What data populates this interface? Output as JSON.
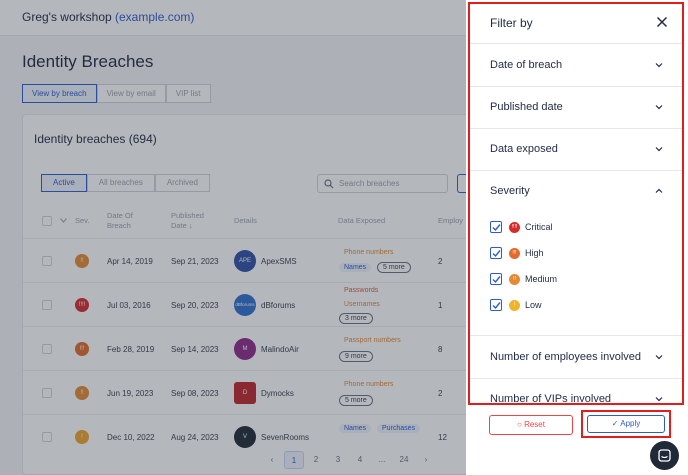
{
  "header": {
    "workspace_name": "Greg's workshop",
    "workspace_domain": "(example.com)"
  },
  "page": {
    "title": "Identity Breaches"
  },
  "view_tabs": [
    {
      "label": "View by breach",
      "active": true
    },
    {
      "label": "View by email",
      "active": false
    },
    {
      "label": "VIP list",
      "active": false
    }
  ],
  "card": {
    "title": "Identity breaches (694)",
    "sub_tabs": [
      {
        "label": "Active",
        "active": true
      },
      {
        "label": "All breaches",
        "active": false
      },
      {
        "label": "Archived",
        "active": false
      }
    ],
    "search_placeholder": "Search breaches"
  },
  "table": {
    "headers": {
      "sev": "Sev.",
      "date_of_breach": "Date Of Breach",
      "published_date": "Published Date ↓",
      "details": "Details",
      "data_exposed": "Data Exposed",
      "employees": "Employ"
    },
    "rows": [
      {
        "sev": "!!",
        "sev_color": "#e58a34",
        "date": "Apr 14, 2019",
        "published": "Sep 21, 2023",
        "logo": "APE",
        "logo_color": "#2f4fa8",
        "name": "ApexSMS",
        "chips": [
          "Phone numbers",
          "Names"
        ],
        "more": "5 more",
        "count": "2"
      },
      {
        "sev": "!!!!",
        "sev_color": "#d62b2b",
        "date": "Jul 03, 2016",
        "published": "Sep 20, 2023",
        "logo": "dBforums",
        "logo_color": "#2e6fcf",
        "name": "dBforums",
        "chips": [
          "Passwords",
          "Usernames"
        ],
        "more": "3 more",
        "count": "1"
      },
      {
        "sev": "!!!",
        "sev_color": "#e36a2a",
        "date": "Feb 28, 2019",
        "published": "Sep 14, 2023",
        "logo": "M",
        "logo_color": "#8e2a8a",
        "name": "MalindoAir",
        "chips": [
          "Passport numbers"
        ],
        "more": "9 more",
        "count": "8"
      },
      {
        "sev": "!!",
        "sev_color": "#e58a34",
        "date": "Jun 19, 2023",
        "published": "Sep 08, 2023",
        "logo": "D",
        "logo_color": "#c0262d",
        "name": "Dymocks",
        "chips": [
          "Phone numbers"
        ],
        "more": "5 more",
        "count": "2"
      },
      {
        "sev": "!",
        "sev_color": "#f0a52c",
        "date": "Dec 10, 2022",
        "published": "Aug 24, 2023",
        "logo": "V",
        "logo_color": "#1f2937",
        "name": "SevenRooms",
        "chips": [
          "Names",
          "Purchases"
        ],
        "more": "",
        "count": "12"
      }
    ]
  },
  "pagination": {
    "pages": [
      "1",
      "2",
      "3",
      "4",
      "...",
      "24"
    ],
    "current": "1"
  },
  "drawer": {
    "title": "Filter by",
    "sections": [
      {
        "label": "Date of breach",
        "expanded": false
      },
      {
        "label": "Published date",
        "expanded": false
      },
      {
        "label": "Data exposed",
        "expanded": false
      },
      {
        "label": "Severity",
        "expanded": true
      },
      {
        "label": "Number of employees involved",
        "expanded": false
      },
      {
        "label": "Number of VIPs involved",
        "expanded": false
      }
    ],
    "severity_options": [
      {
        "label": "Critical",
        "checked": true,
        "dot": "!!!!",
        "color": "#d62b2b"
      },
      {
        "label": "High",
        "checked": true,
        "dot": "!!!",
        "color": "#e36a2a"
      },
      {
        "label": "Medium",
        "checked": true,
        "dot": "!!",
        "color": "#e58a34"
      },
      {
        "label": "Low",
        "checked": true,
        "dot": "!",
        "color": "#f0b42c"
      }
    ],
    "reset_label": "○ Reset",
    "apply_label": "✓ Apply"
  },
  "colors": {
    "accent": "#2f5bd2",
    "highlight": "#e11d1d",
    "danger": "#ef4444"
  }
}
